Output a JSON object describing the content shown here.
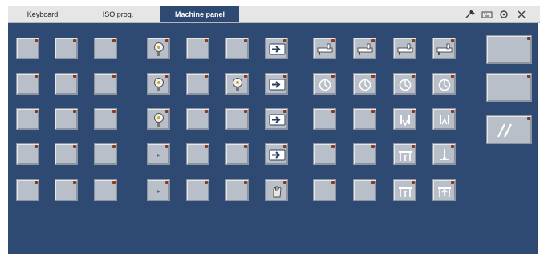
{
  "tabs": [
    {
      "label": "Keyboard",
      "active": false
    },
    {
      "label": "ISO prog.",
      "active": false
    },
    {
      "label": "Machine panel",
      "active": true
    }
  ],
  "toolbar_icons": [
    "tool-wrench-icon",
    "keyboard-icon",
    "settings-icon",
    "close-icon"
  ],
  "colors": {
    "panel_bg": "#2e4a73",
    "tab_active": "#2e4a73",
    "key_face": "#b9bfc8",
    "led": "#8a3a1a"
  },
  "grid_columns": [
    [
      "blank",
      "blank",
      "blank",
      "blank",
      "blank"
    ],
    [
      "blank",
      "blank",
      "blank",
      "blank",
      "blank"
    ],
    [
      "blank",
      "blank",
      "blank",
      "blank",
      "blank"
    ],
    [
      "bulb-icon",
      "bulb-icon",
      "bulb-icon",
      "small-mark-icon",
      "small-mark-icon"
    ],
    [
      "blank",
      "blank",
      "blank",
      "blank",
      "blank"
    ],
    [
      "blank",
      "bulb-icon",
      "blank",
      "blank",
      "blank"
    ],
    [
      "arrow-right-icon",
      "arrow-right-icon",
      "arrow-right-icon",
      "arrow-right-icon",
      "hand-icon"
    ],
    [
      "coolant-tap-icon",
      "spindle-dial-icon",
      "blank",
      "blank",
      "blank"
    ],
    [
      "coolant-tap-icon",
      "spindle-dial-icon",
      "blank",
      "blank",
      "blank"
    ],
    [
      "coolant-tap-icon",
      "spindle-dial-icon",
      "clamp-open-icon",
      "table-clamp-icon",
      "table-clamp-icon"
    ],
    [
      "coolant-tap-icon",
      "spindle-dial-icon",
      "clamp-close-icon",
      "probe-icon",
      "table-unclamp-icon"
    ]
  ],
  "side_keys": [
    "blank",
    "blank",
    "hatch-icon"
  ]
}
